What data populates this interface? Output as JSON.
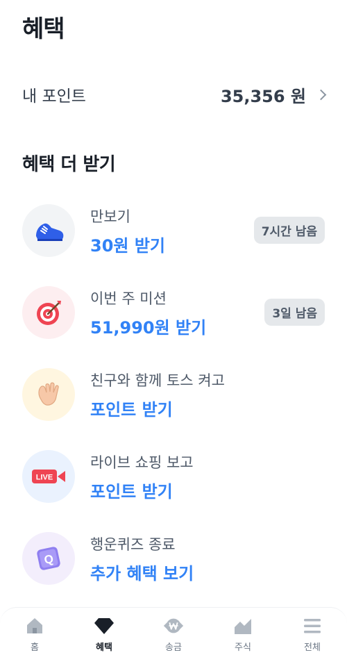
{
  "header": {
    "title": "혜택"
  },
  "points": {
    "label": "내 포인트",
    "value": "35,356 원"
  },
  "section": {
    "title": "혜택 더 받기"
  },
  "benefits": [
    {
      "title": "만보기",
      "action": "30원 받기",
      "badge": "7시간 남음",
      "icon": "sneaker-icon"
    },
    {
      "title": "이번 주 미션",
      "action": "51,990원 받기",
      "badge": "3일 남음",
      "icon": "target-icon"
    },
    {
      "title": "친구와 함께 토스 켜고",
      "action": "포인트 받기",
      "icon": "waving-hand-icon"
    },
    {
      "title": "라이브 쇼핑 보고",
      "action": "포인트 받기",
      "icon": "live-video-icon",
      "live_text": "LIVE"
    },
    {
      "title": "행운퀴즈 종료",
      "action": "추가 혜택 보기",
      "icon": "quiz-icon",
      "quiz_text": "Q"
    }
  ],
  "nav": [
    {
      "label": "홈",
      "icon": "home-icon",
      "active": false
    },
    {
      "label": "혜택",
      "icon": "gem-icon",
      "active": true
    },
    {
      "label": "송금",
      "icon": "won-transfer-icon",
      "active": false
    },
    {
      "label": "주식",
      "icon": "chart-icon",
      "active": false
    },
    {
      "label": "전체",
      "icon": "menu-icon",
      "active": false
    }
  ],
  "colors": {
    "accent": "#3182f6",
    "text": "#191f28",
    "badge_bg": "#e5e8eb"
  }
}
